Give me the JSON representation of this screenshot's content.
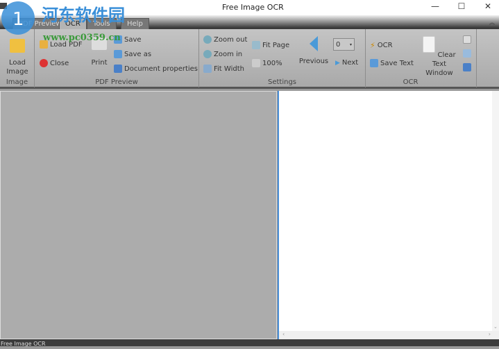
{
  "window": {
    "title": "Free Image OCR",
    "minimize": "—",
    "maximize": "☐",
    "close": "✕"
  },
  "tabs": [
    {
      "label": "PDF Preview"
    },
    {
      "label": "OCR"
    },
    {
      "label": "Tools"
    },
    {
      "label": "Help"
    }
  ],
  "active_tab": "OCR",
  "ribbon": {
    "image": {
      "label": "Image",
      "load_image": "Load Image"
    },
    "pdf_preview": {
      "label": "PDF Preview",
      "load_pdf": "Load PDF",
      "close": "Close",
      "print": "Print",
      "save": "Save",
      "save_as": "Save as",
      "document_properties": "Document properties"
    },
    "settings": {
      "label": "Settings",
      "zoom_out": "Zoom out",
      "zoom_in": "Zoom in",
      "fit_width": "Fit Width",
      "fit_page": "Fit Page",
      "zoom_100": "100%",
      "previous": "Previous",
      "next": "Next",
      "page_value": "0"
    },
    "ocr": {
      "label": "OCR",
      "ocr": "OCR",
      "save_text": "Save Text",
      "clear_text_window": "Clear Text Window"
    }
  },
  "statusbar": {
    "text": "Free Image OCR"
  },
  "watermark": {
    "text": "河东软件园",
    "url": "www.pc0359.cn"
  },
  "colors": {
    "accent": "#4a90d9",
    "ribbon": "#b4b4b4",
    "pane": "#acacac"
  }
}
